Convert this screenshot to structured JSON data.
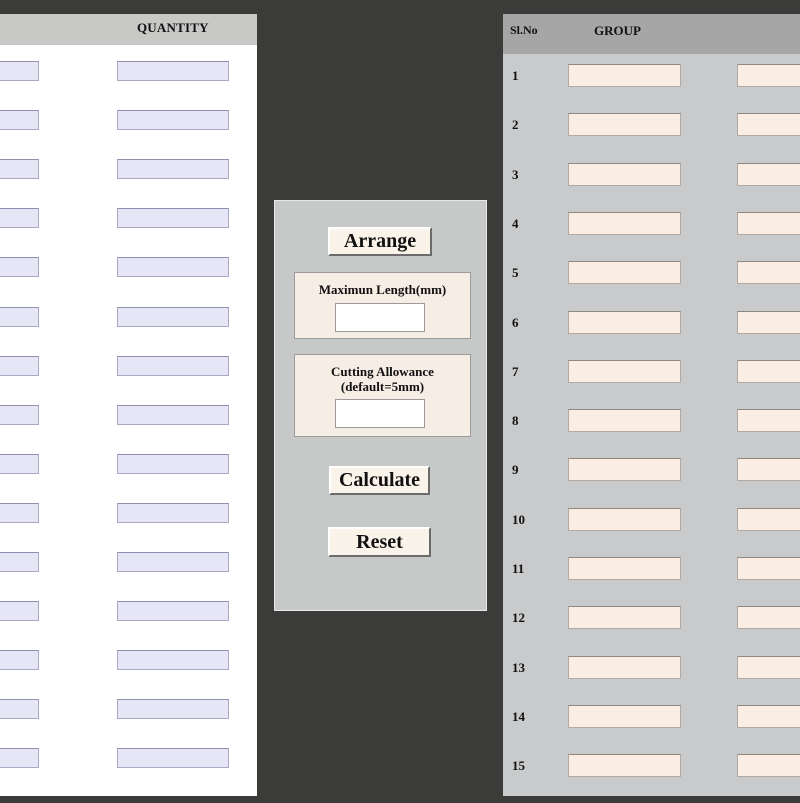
{
  "left_table": {
    "header": {
      "quantity": "QUANTITY"
    },
    "row_count": 15
  },
  "controls": {
    "arrange_label": "Arrange",
    "max_length_label": "Maximun Length(mm)",
    "max_length_value": "",
    "cutting_allowance_label_line1": "Cutting Allowance",
    "cutting_allowance_label_line2": "(default=5mm)",
    "cutting_allowance_value": "",
    "calculate_label": "Calculate",
    "reset_label": "Reset"
  },
  "right_table": {
    "header": {
      "slno": "Sl.No",
      "group": "GROUP"
    },
    "rows": [
      "1",
      "2",
      "3",
      "4",
      "5",
      "6",
      "7",
      "8",
      "9",
      "10",
      "11",
      "12",
      "13",
      "14",
      "15"
    ]
  },
  "colors": {
    "background": "#3b3b39",
    "left_input": "#e6e6f6",
    "right_input": "#faeee4",
    "button": "#faf3ea"
  }
}
